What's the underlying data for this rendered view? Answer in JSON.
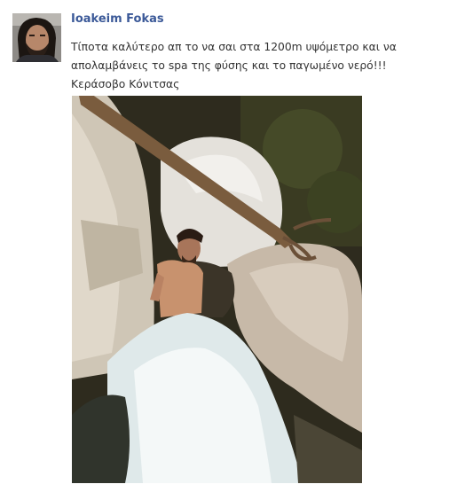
{
  "post": {
    "author_name": "Ioakeim Fokas",
    "message": "Τίποτα καλύτερο απ το να σαι στα 1200m υψόμετρο και να απολαμβάνεις το spa της φύσης και το παγωμένο νερό!!!Κεράσοβο Κόνιτσας"
  },
  "colors": {
    "author_link": "#3b5998",
    "text": "#333333",
    "background": "#ffffff"
  }
}
